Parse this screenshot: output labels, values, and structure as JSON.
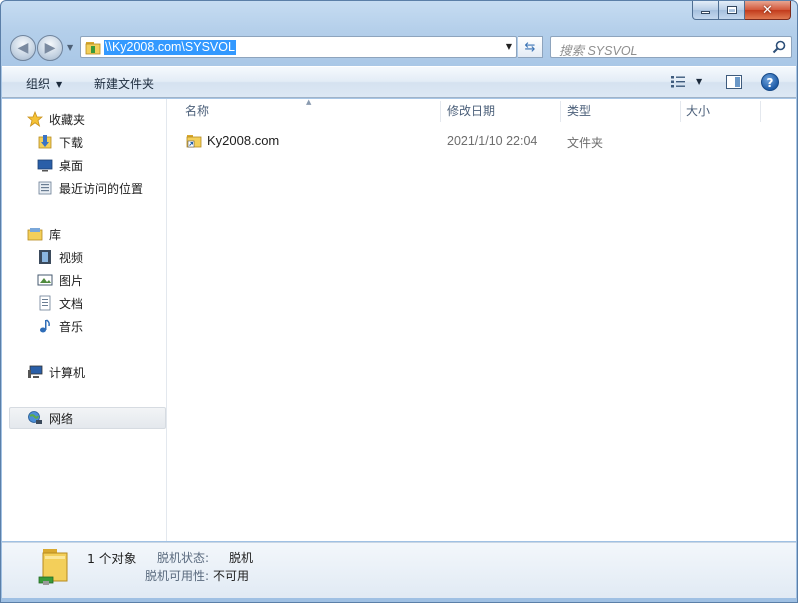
{
  "address": {
    "path": "\\\\Ky2008.com\\SYSVOL",
    "search_placeholder": "搜索 SYSVOL"
  },
  "toolbar": {
    "organize_label": "组织",
    "new_folder_label": "新建文件夹",
    "help_label": "?"
  },
  "nav_pane": {
    "favorites": {
      "label": "收藏夹",
      "items": [
        "下载",
        "桌面",
        "最近访问的位置"
      ]
    },
    "libraries": {
      "label": "库",
      "items": [
        "视频",
        "图片",
        "文档",
        "音乐"
      ]
    },
    "computer": "计算机",
    "network": "网络"
  },
  "columns": {
    "name": "名称",
    "date": "修改日期",
    "type": "类型",
    "size": "大小"
  },
  "files": [
    {
      "name": "Ky2008.com",
      "date": "2021/1/10 22:04",
      "type": "文件夹",
      "icon": "folder-shortcut-icon"
    }
  ],
  "details": {
    "count": "1 个对象",
    "offline_status_label": "脱机状态:",
    "offline_status_value": "脱机",
    "offline_avail_label": "脱机可用性:",
    "offline_avail_value": "不可用"
  },
  "colors": {
    "selection": "#3399ff",
    "chrome": "#b4cfea",
    "close_button": "#c23b1c"
  }
}
